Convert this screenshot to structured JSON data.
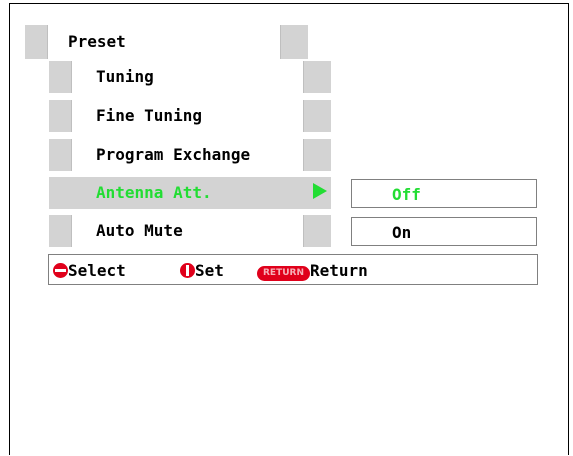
{
  "menu": {
    "title": "Preset",
    "items": [
      {
        "label": "Tuning"
      },
      {
        "label": "Fine Tuning"
      },
      {
        "label": "Program Exchange"
      },
      {
        "label": "Antenna Att."
      },
      {
        "label": "Auto Mute"
      }
    ],
    "selected_item": "Antenna Att."
  },
  "options": [
    {
      "value": "Off",
      "highlighted": true
    },
    {
      "value": "On",
      "highlighted": false
    }
  ],
  "help": {
    "select_label": "Select",
    "set_label": "Set",
    "return_button_text": "RETURN",
    "return_label": "Return"
  },
  "colors": {
    "highlight": "#22dd33",
    "menu_gray": "#d3d3d3",
    "button_red": "#e0001b"
  },
  "icons": [
    "up-down-button-icon",
    "left-right-button-icon",
    "return-button-icon",
    "selection-arrow-icon"
  ]
}
